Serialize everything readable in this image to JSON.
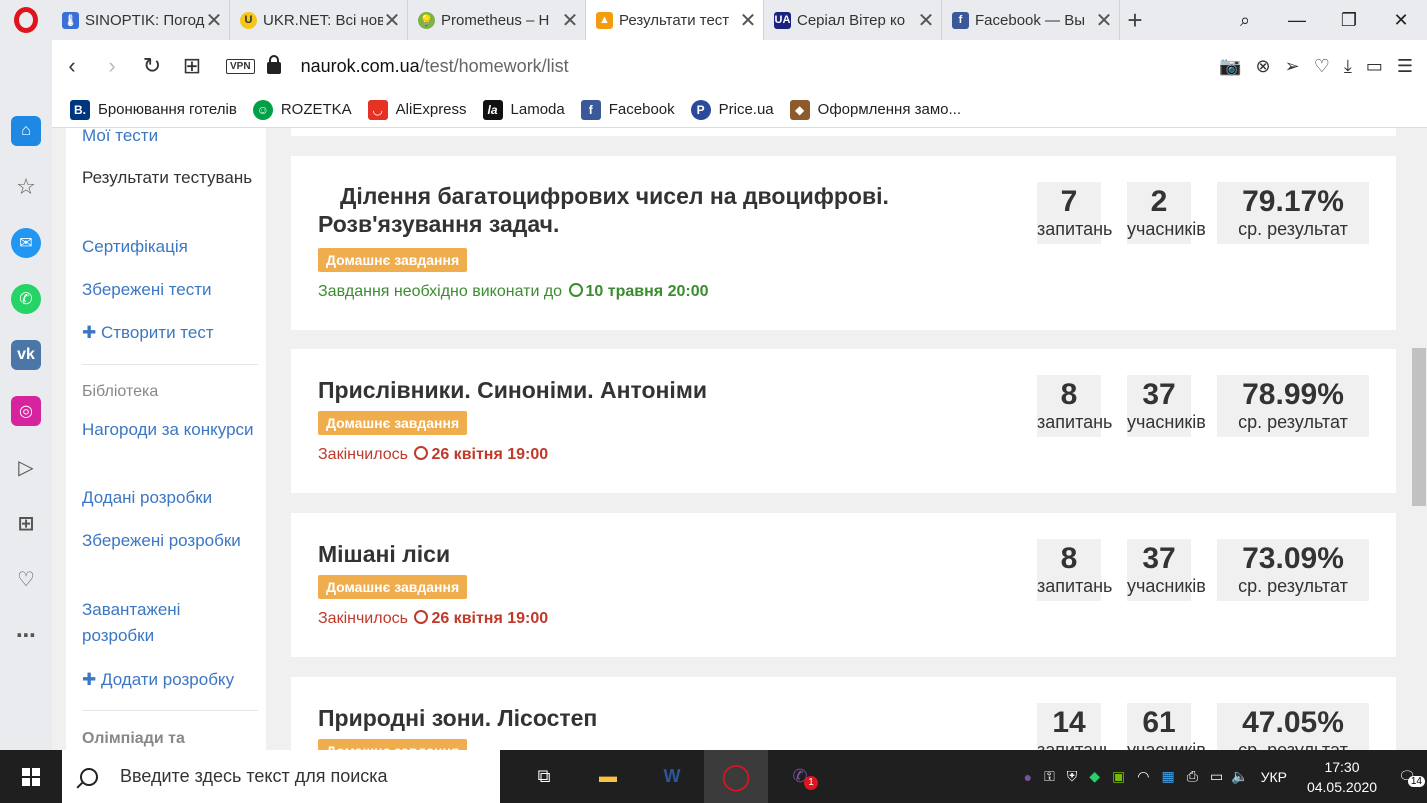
{
  "tabs": [
    {
      "title": "SINOPTIK: Погода",
      "icon_color": "#3a6fd8",
      "icon": "thermometer-icon"
    },
    {
      "title": "UKR.NET: Всі новини",
      "icon_color": "#f5c518",
      "icon": "ukrnet-icon"
    },
    {
      "title": "Prometheus – Н",
      "icon_color": "#7cb342",
      "icon": "bulb-icon"
    },
    {
      "title": "Результати тест",
      "icon_color": "#f39c12",
      "icon": "naurok-icon",
      "active": true
    },
    {
      "title": "Серіал Вітер ко",
      "icon_color": "#1a237e",
      "icon": "ua-icon"
    },
    {
      "title": "Facebook — Вы",
      "icon_color": "#3b5998",
      "icon": "facebook-icon"
    }
  ],
  "address": {
    "vpn": "VPN",
    "domain": "naurok.com.ua",
    "path": "/test/homework/list"
  },
  "bookmarks": [
    {
      "label": "Бронювання готелів",
      "icon_color": "#003580",
      "glyph": "B."
    },
    {
      "label": "ROZETKA",
      "icon_color": "#00a046",
      "glyph": "☺"
    },
    {
      "label": "AliExpress",
      "icon_color": "#e43225",
      "glyph": "◡"
    },
    {
      "label": "Lamoda",
      "icon_color": "#111111",
      "glyph": "la"
    },
    {
      "label": "Facebook",
      "icon_color": "#3b5998",
      "glyph": "f"
    },
    {
      "label": "Price.ua",
      "icon_color": "#2b4a9b",
      "glyph": "P"
    },
    {
      "label": "Оформлення замо...",
      "icon_color": "#8d5a2b",
      "glyph": "◆"
    }
  ],
  "leftnav": {
    "my_tests": "Мої тести",
    "results": "Результати тестувань",
    "certification": "Сертифікація",
    "saved_tests": "Збережені тести",
    "create_test": "Створити тест",
    "library": "Бібліотека",
    "awards": "Нагороди за конкурси",
    "added_dev": "Додані розробки",
    "saved_dev": "Збережені розробки",
    "uploaded_dev": "Завантажені розробки",
    "add_dev": "Додати розробку",
    "olympiads": "Олімпіади та"
  },
  "labels": {
    "questions": "запитань",
    "participants": "учасників",
    "avg": "ср. результат",
    "homework": "Домашнє завдання"
  },
  "cards": [
    {
      "title": "Ділення багатоцифрових чисел на двоцифрові. Розв'язування задач.",
      "status_text": "Завдання необхідно виконати до",
      "deadline": "10 травня 20:00",
      "questions": "7",
      "participants": "2",
      "result": "79.17%"
    },
    {
      "title": "Прислівники. Синоніми. Антоніми",
      "status_text": "Закінчилось",
      "deadline": "26 квітня 19:00",
      "questions": "8",
      "participants": "37",
      "result": "78.99%"
    },
    {
      "title": "Мішані ліси",
      "status_text": "Закінчилось",
      "deadline": "26 квітня 19:00",
      "questions": "8",
      "participants": "37",
      "result": "73.09%"
    },
    {
      "title": "Природні зони. Лісостеп",
      "status_text": "",
      "deadline": "",
      "questions": "14",
      "participants": "61",
      "result": "47.05%"
    }
  ],
  "taskbar": {
    "search_placeholder": "Введите здесь текст для поиска",
    "lang": "УКР",
    "time": "17:30",
    "date": "04.05.2020",
    "notif_count": "14",
    "viber_badge": "1"
  }
}
